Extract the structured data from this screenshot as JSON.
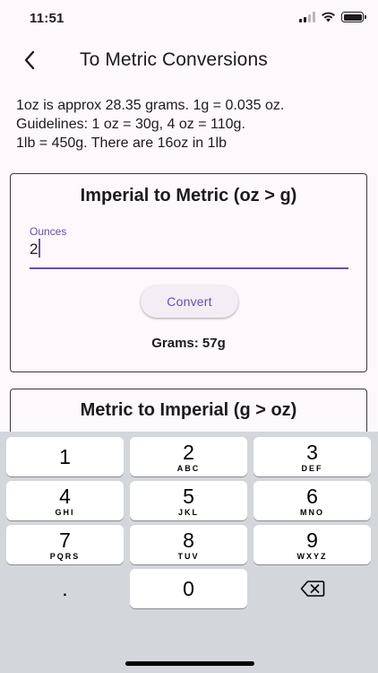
{
  "status_bar": {
    "time": "11:51"
  },
  "app_bar": {
    "title": "To Metric Conversions"
  },
  "info": {
    "line1": "1oz is approx 28.35 grams. 1g = 0.035 oz.",
    "line2": "Guidelines: 1 oz = 30g, 4 oz = 110g.",
    "line3": "1lb = 450g. There are 16oz in 1lb"
  },
  "imperial_card": {
    "title": "Imperial to Metric (oz > g)",
    "field_label": "Ounces",
    "field_value": "2",
    "button_label": "Convert",
    "result": "Grams: 57g"
  },
  "metric_card": {
    "title": "Metric to Imperial (g > oz)"
  },
  "keyboard": {
    "keys": [
      {
        "digit": "1",
        "letters": ""
      },
      {
        "digit": "2",
        "letters": "ABC"
      },
      {
        "digit": "3",
        "letters": "DEF"
      },
      {
        "digit": "4",
        "letters": "GHI"
      },
      {
        "digit": "5",
        "letters": "JKL"
      },
      {
        "digit": "6",
        "letters": "MNO"
      },
      {
        "digit": "7",
        "letters": "PQRS"
      },
      {
        "digit": "8",
        "letters": "TUV"
      },
      {
        "digit": "9",
        "letters": "WXYZ"
      },
      {
        "digit": "0",
        "letters": ""
      }
    ],
    "decimal_label": ".",
    "delete_icon": "backspace-icon"
  },
  "colors": {
    "accent": "#6750a4",
    "background": "#fdf8fb",
    "keyboard": "#d3d6db"
  }
}
